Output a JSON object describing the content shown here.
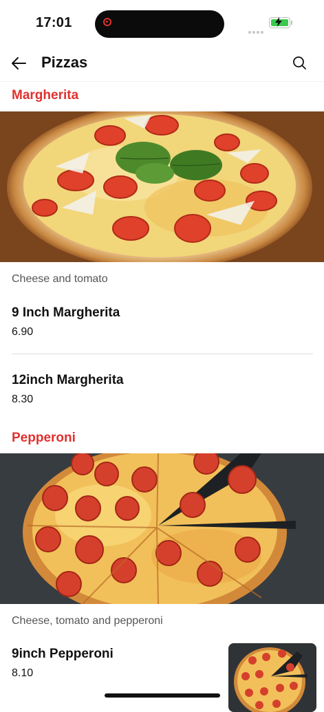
{
  "status_bar": {
    "time": "17:01"
  },
  "header": {
    "title": "Pizzas"
  },
  "sections": [
    {
      "title": "Margherita",
      "description": "Cheese and tomato",
      "items": [
        {
          "name": "9 Inch Margherita",
          "price": "6.90"
        },
        {
          "name": "12inch Margherita",
          "price": "8.30"
        }
      ]
    },
    {
      "title": "Pepperoni",
      "description": "Cheese, tomato and pepperoni",
      "items": [
        {
          "name": "9inch Pepperoni",
          "price": "8.10"
        }
      ]
    }
  ],
  "colors": {
    "accent": "#e0312e",
    "battery": "#3bc94f"
  },
  "icons": [
    "back-arrow-icon",
    "search-icon",
    "battery-icon",
    "signal-icon",
    "recording-icon"
  ]
}
